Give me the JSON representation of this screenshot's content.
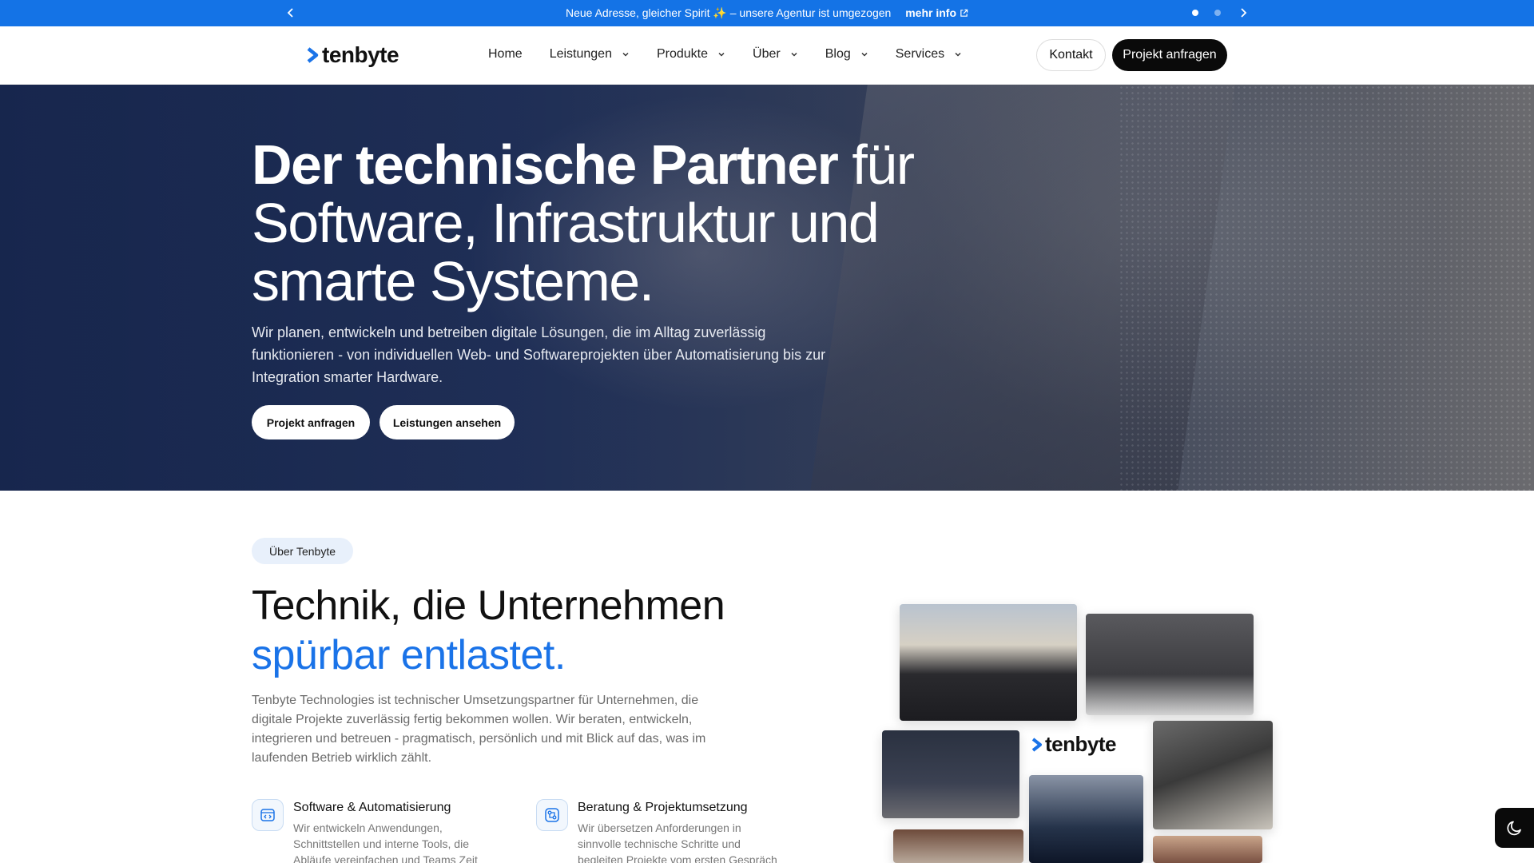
{
  "announcement": {
    "message": "Neue Adresse, gleicher Spirit ✨ – unsere Agentur ist umgezogen",
    "link_label": "mehr info"
  },
  "header": {
    "logo_text": "tenbyte",
    "nav": [
      "Home",
      "Leistungen",
      "Produkte",
      "Über",
      "Blog",
      "Services"
    ],
    "contact_label": "Kontakt",
    "request_label": "Projekt anfragen"
  },
  "hero": {
    "title_bold": "Der technische Partner",
    "title_rest": " für Software, Infrastruktur und smarte Systeme.",
    "text": "Wir planen, entwickeln und betreiben digitale Lösungen, die im Alltag zuverlässig funktionieren - von individuellen Web- und Softwareprojekten über Automatisierung bis zur Integration smarter Hardware.",
    "cta_primary": "Projekt anfragen",
    "cta_secondary": "Leistungen ansehen"
  },
  "about": {
    "badge": "Über Tenbyte",
    "heading_line1": "Technik, die Unternehmen",
    "heading_line2": "spürbar entlastet.",
    "text": "Tenbyte Technologies ist technischer Umsetzungspartner für Unternehmen, die digitale Projekte zuverlässig fertig bekommen wollen. Wir beraten, entwickeln, integrieren und betreuen - pragmatisch, persönlich und mit Blick auf das, was im laufenden Betrieb wirklich zählt.",
    "features": [
      {
        "title": "Software & Automatisierung",
        "text": "Wir entwickeln Anwendungen, Schnittstellen und interne Tools, die Abläufe vereinfachen und Teams Zeit",
        "icon": "code-window-icon"
      },
      {
        "title": "Beratung & Projektumsetzung",
        "text": "Wir übersetzen Anforderungen in sinnvolle technische Schritte und begleiten Projekte vom ersten Gespräch bis zum Go-live",
        "icon": "workflow-icon"
      }
    ],
    "collage_logo": "tenbyte"
  },
  "colors": {
    "accent": "#1a73e8",
    "announcement_bg": "#1473e6",
    "button_dark": "#0a0a0a"
  }
}
